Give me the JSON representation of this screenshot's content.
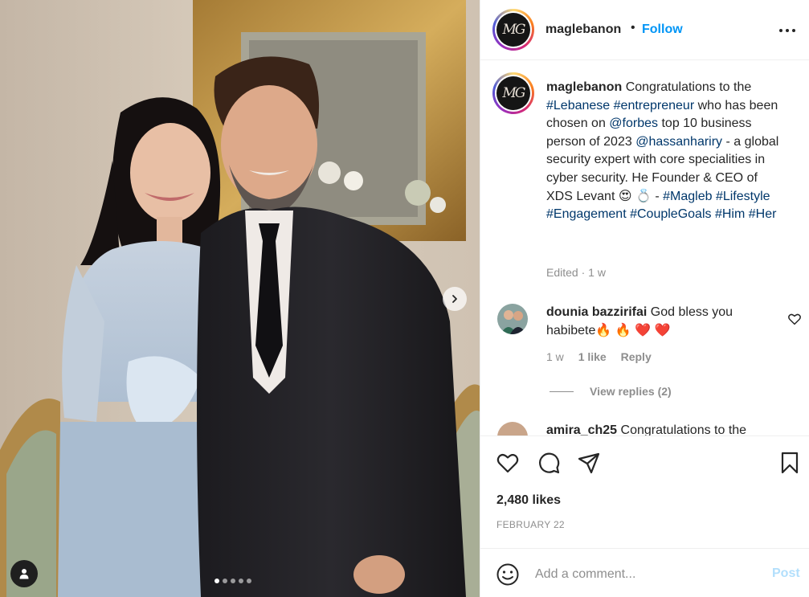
{
  "post": {
    "username": "maglebanon",
    "follow_label": "Follow",
    "bullet": "•",
    "avatar_monogram": "MG",
    "caption": {
      "intro": "Congratulations to the",
      "tag_lebanese": "#Lebanese",
      "tag_entrepreneur": "#entrepreneur",
      "mid1": "who has been chosen on",
      "mention_forbes": "@forbes",
      "mid2": "top 10 business person of 2023",
      "mention_hassan": "@hassanhariry",
      "mid3": "- a global security expert with core specialities in cyber security. He Founder & CEO of XDS Levant 😍 💍 -",
      "tag_magleb": "#Magleb",
      "tag_lifestyle": "#Lifestyle",
      "tag_engagement": "#Engagement",
      "tag_couplegoals": "#CoupleGoals",
      "tag_him": "#Him",
      "tag_her": "#Her"
    },
    "caption_meta": "Edited · 1 w",
    "likes": "2,480 likes",
    "date": "FEBRUARY 22",
    "carousel": {
      "count": 5,
      "active_index": 0
    }
  },
  "comments": [
    {
      "username": "dounia bazzirifai",
      "text": "God bless you habibete🔥 🔥 ❤️ ❤️",
      "age": "1 w",
      "likes_label": "1 like",
      "reply_label": "Reply",
      "view_replies": "View replies (2)"
    },
    {
      "username": "amira_ch25",
      "text": "Congratulations to the"
    }
  ],
  "composer": {
    "placeholder": "Add a comment...",
    "post_label": "Post"
  },
  "icons": {
    "more": "more-horizontal-icon",
    "next": "chevron-right-icon",
    "tag": "user-tag-icon",
    "like": "heart-icon",
    "comment": "comment-bubble-icon",
    "share": "paper-plane-icon",
    "save": "bookmark-icon",
    "emoji": "smiley-icon"
  },
  "colors": {
    "link": "#00376b",
    "follow": "#0095f6",
    "post_disabled": "#b2dffc",
    "muted": "#8e8e8e"
  }
}
